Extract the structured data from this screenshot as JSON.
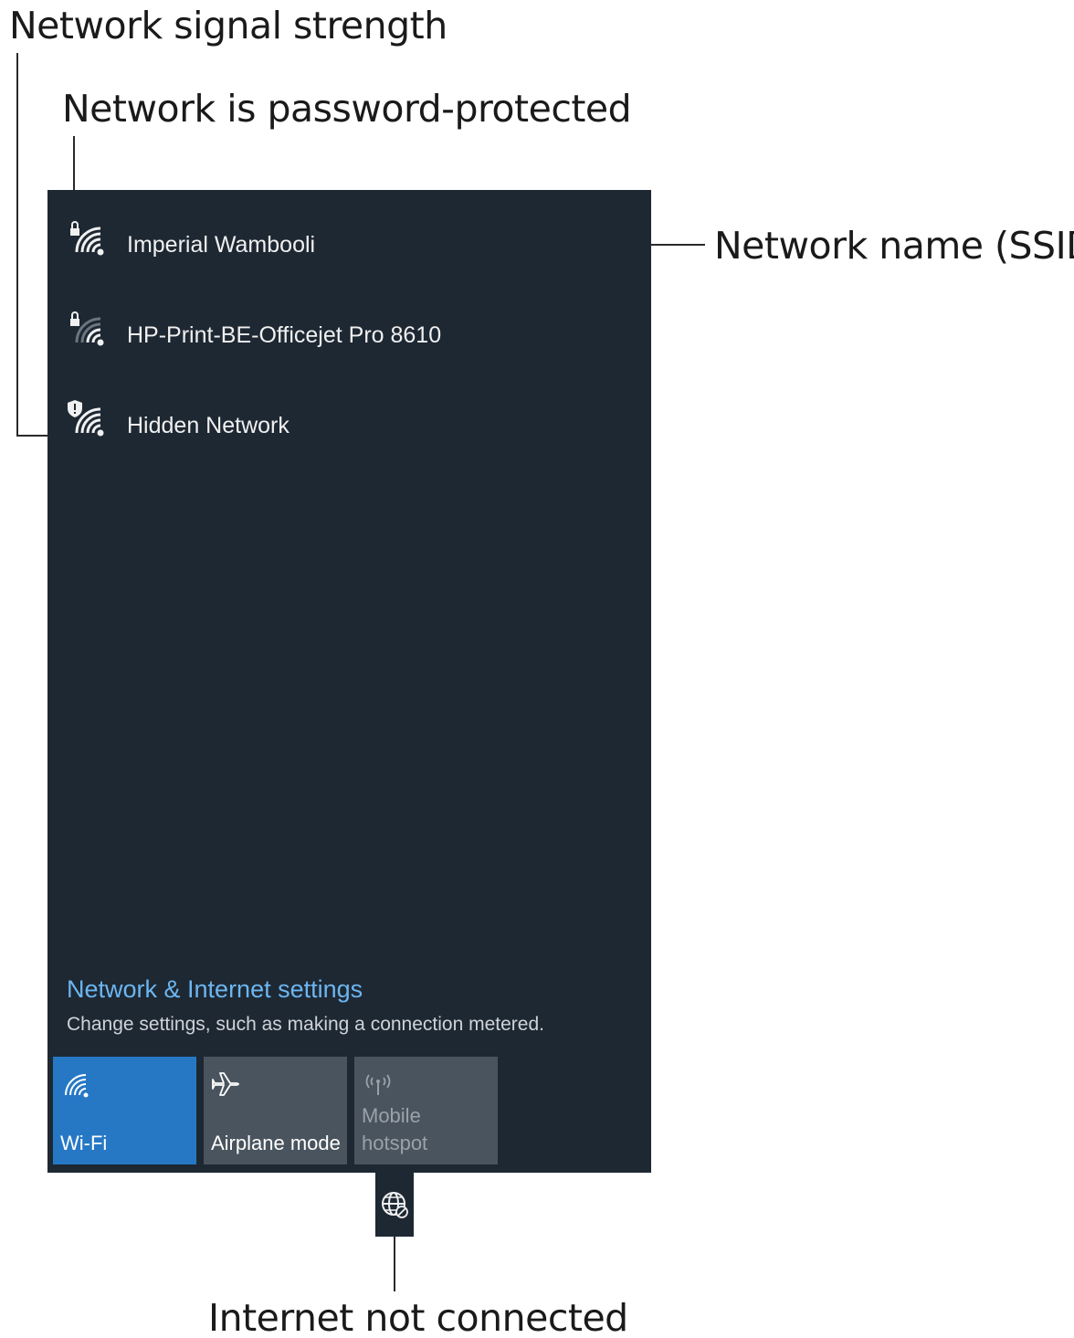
{
  "callouts": {
    "signal_strength": "Network signal strength",
    "password_protected": "Network is password-protected",
    "network_name": "Network name (SSID)",
    "internet_not_connected": "Internet not connected"
  },
  "networks": [
    {
      "name": "Imperial Wambooli",
      "badge": "lock-icon"
    },
    {
      "name": "HP-Print-BE-Officejet Pro 8610",
      "badge": "lock-icon"
    },
    {
      "name": "Hidden Network",
      "badge": "shield-icon"
    }
  ],
  "settings": {
    "link": "Network & Internet settings",
    "description": "Change settings, such as making a connection metered."
  },
  "tiles": {
    "wifi": {
      "label": "Wi-Fi",
      "icon": "wifi-icon",
      "state": "on"
    },
    "airplane": {
      "label": "Airplane mode",
      "icon": "airplane-icon",
      "state": "off"
    },
    "hotspot": {
      "line1": "Mobile",
      "line2": "hotspot",
      "icon": "hotspot-icon",
      "state": "disabled"
    }
  },
  "taskbar": {
    "icon": "globe-no-internet-icon"
  },
  "colors": {
    "panel": "#1e2833",
    "link": "#6cb6f0",
    "wifi_tile": "#2678c5",
    "inactive_tile": "#4a545e"
  }
}
